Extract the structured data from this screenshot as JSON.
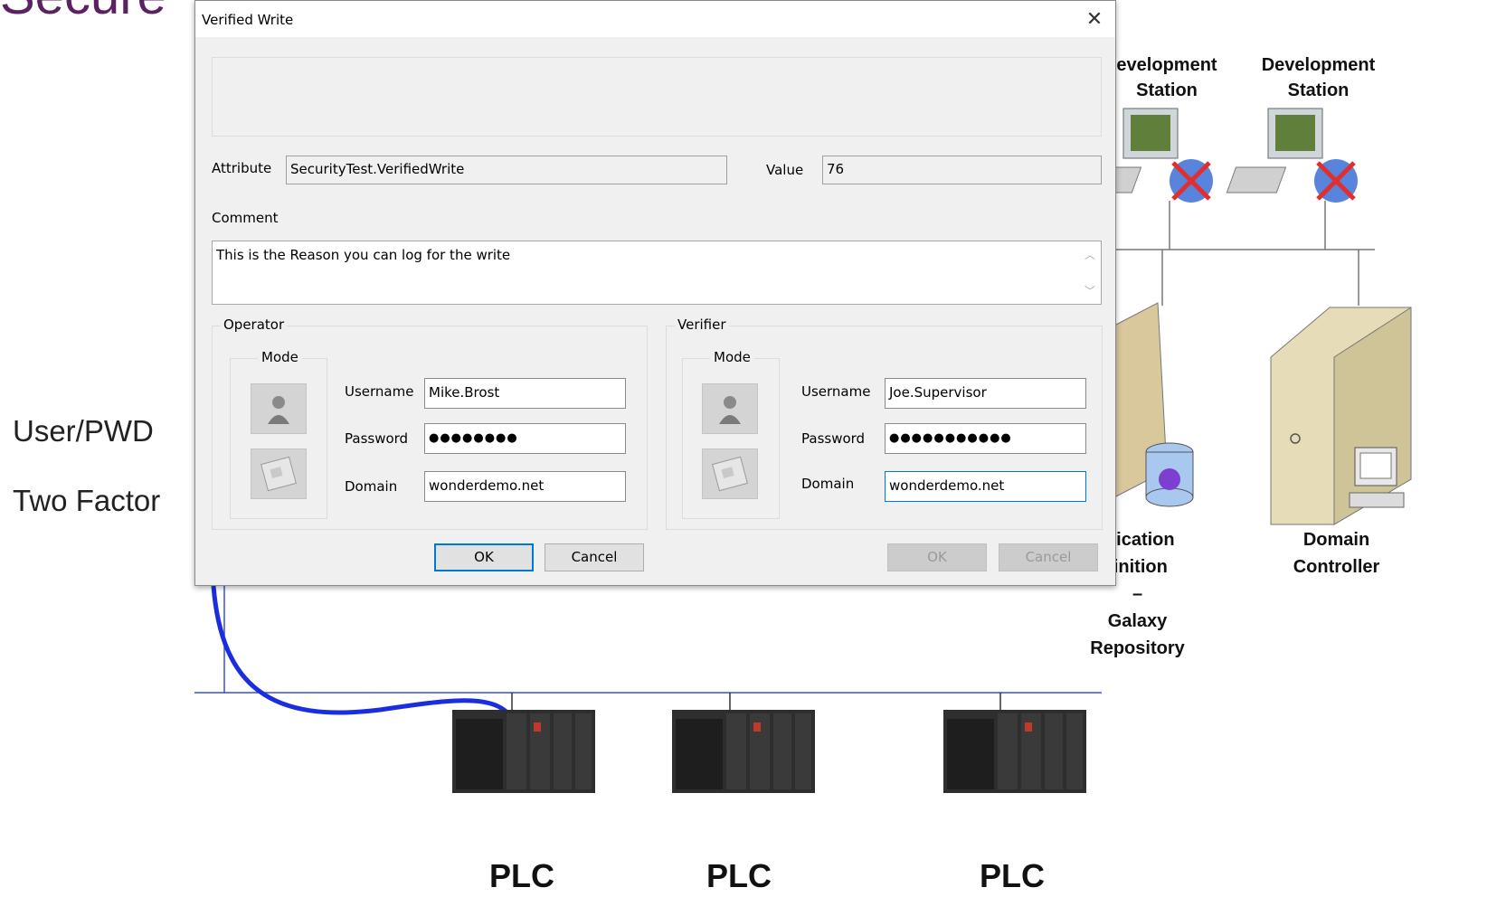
{
  "slide": {
    "title_fragment": "Secure",
    "side_labels": [
      "User/PWD",
      "Two Factor"
    ],
    "workstations": [
      {
        "line1": "evelopment",
        "line2": "Station"
      },
      {
        "line1": "Development",
        "line2": "Station"
      }
    ],
    "servers": [
      {
        "lines": [
          "plication",
          "finition",
          "–",
          "Galaxy",
          "Repository"
        ]
      },
      {
        "lines": [
          "Domain",
          "Controller"
        ]
      }
    ],
    "plc_labels": [
      "PLC",
      "PLC",
      "PLC"
    ],
    "colors": {
      "title": "#5c2163",
      "network_line": "#3a4fd6",
      "arrow": "#1a2ee0"
    }
  },
  "dialog": {
    "title": "Verified Write",
    "close_icon": "close-icon",
    "attribute_label": "Attribute",
    "attribute_value": "SecurityTest.VerifiedWrite",
    "value_label": "Value",
    "value_value": "76",
    "comment_label": "Comment",
    "comment_value": "This is the Reason you can log for the write",
    "operator": {
      "group_label": "Operator",
      "mode_label": "Mode",
      "username_label": "Username",
      "username_value": "Mike.Brost",
      "password_label": "Password",
      "password_value": "●●●●●●●●",
      "domain_label": "Domain",
      "domain_value": "wonderdemo.net",
      "ok_label": "OK",
      "cancel_label": "Cancel"
    },
    "verifier": {
      "group_label": "Verifier",
      "mode_label": "Mode",
      "username_label": "Username",
      "username_value": "Joe.Supervisor",
      "password_label": "Password",
      "password_value": "●●●●●●●●●●●",
      "domain_label": "Domain",
      "domain_value": "wonderdemo.net",
      "ok_label": "OK",
      "cancel_label": "Cancel"
    }
  }
}
